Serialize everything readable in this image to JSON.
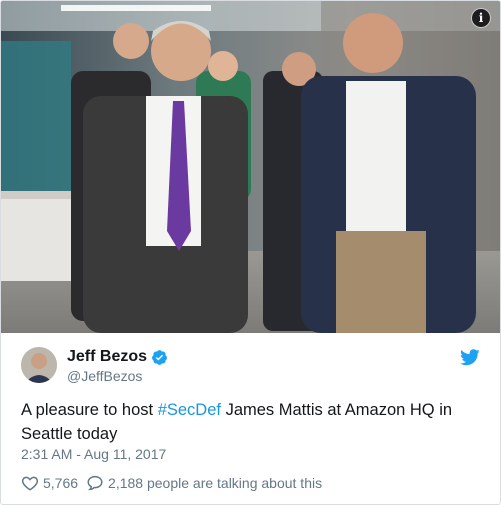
{
  "tweet": {
    "display_name": "Jeff Bezos",
    "handle": "@JeffBezos",
    "text_before": "A pleasure to host ",
    "hashtag": "#SecDef",
    "text_after": " James Mattis at Amazon HQ in Seattle today",
    "timestamp": "2:31 AM - Aug 11, 2017",
    "likes": "5,766",
    "replies_text": "2,188 people are talking about this"
  },
  "icons": {
    "info": "info-icon",
    "verified": "verified-badge-icon",
    "twitter": "twitter-bird-icon",
    "like": "heart-icon",
    "reply": "reply-bubble-icon"
  },
  "colors": {
    "link": "#1b95e0",
    "text": "#14171a",
    "muted": "#657786",
    "brand": "#1da1f2"
  }
}
